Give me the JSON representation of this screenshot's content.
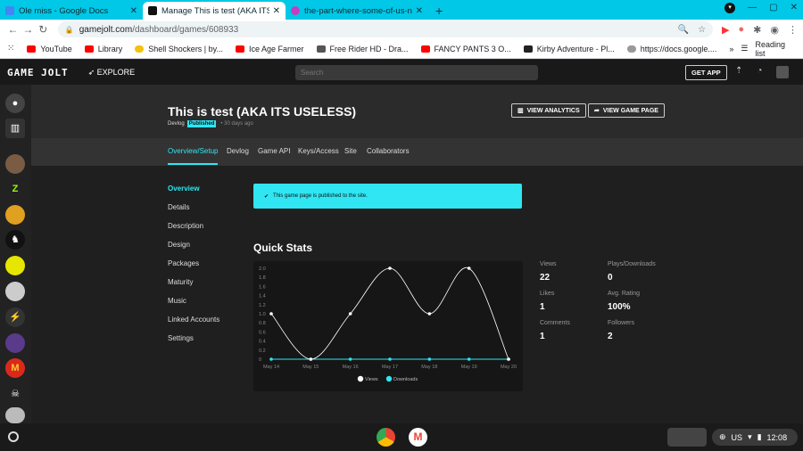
{
  "browser": {
    "tabs": [
      {
        "title": "Ole miss - Google Docs",
        "color": "#4285f4"
      },
      {
        "title": "Manage This is test (AKA ITS US",
        "color": "#111111"
      },
      {
        "title": "the-part-where-some-of-us-need-",
        "color": "#c040c0"
      }
    ],
    "new_tab": "+",
    "url_host": "gamejolt.com",
    "url_path": "/dashboard/games/608933",
    "bookmarks": [
      {
        "label": "YouTube",
        "color": "#ff0000"
      },
      {
        "label": "Library",
        "color": "#ff0000"
      },
      {
        "label": "Shell Shockers | by...",
        "color": "#f4c20d"
      },
      {
        "label": "Ice Age Farmer",
        "color": "#ff0000"
      },
      {
        "label": "Free Rider HD - Dra...",
        "color": "#555555"
      },
      {
        "label": "FANCY PANTS 3 O...",
        "color": "#ff0000"
      },
      {
        "label": "Kirby Adventure - Pl...",
        "color": "#222222"
      },
      {
        "label": "https://docs.google....",
        "color": "#999999"
      }
    ],
    "bookmarks_more": "»",
    "reading_list": "Reading list"
  },
  "gj": {
    "logo": "GAME JOLT",
    "explore": "EXPLORE",
    "search_placeholder": "Search",
    "get_app": "GET APP"
  },
  "header": {
    "title": "This is test (AKA ITS USELESS)",
    "badge_devlog": "Devlog",
    "badge_published": "Published",
    "ago": "30 days ago",
    "view_analytics": "VIEW ANALYTICS",
    "view_game_page": "VIEW GAME PAGE"
  },
  "tabs": [
    "Overview/Setup",
    "Devlog",
    "Game API",
    "Keys/Access",
    "Site",
    "Collaborators"
  ],
  "sidebar": [
    "Overview",
    "Details",
    "Description",
    "Design",
    "Packages",
    "Maturity",
    "Music",
    "Linked Accounts",
    "Settings"
  ],
  "notice": "This game page is published to the site.",
  "quick_stats_title": "Quick Stats",
  "stats": [
    {
      "label": "Views",
      "value": "22"
    },
    {
      "label": "Plays/Downloads",
      "value": "0"
    },
    {
      "label": "Likes",
      "value": "1"
    },
    {
      "label": "Avg. Rating",
      "value": "100%"
    },
    {
      "label": "Comments",
      "value": "1"
    },
    {
      "label": "Followers",
      "value": "2"
    }
  ],
  "chart_data": {
    "type": "line",
    "x": [
      "May 14",
      "May 15",
      "May 16",
      "May 17",
      "May 18",
      "May 19",
      "May 20"
    ],
    "series": [
      {
        "name": "Views",
        "values": [
          1,
          0,
          1,
          2,
          1,
          2,
          0
        ],
        "color": "#ffffff"
      },
      {
        "name": "Downloads",
        "values": [
          0,
          0,
          0,
          0,
          0,
          0,
          0
        ],
        "color": "#2fe6f2"
      }
    ],
    "yticks": [
      "2.0",
      "1.8",
      "1.6",
      "1.4",
      "1.2",
      "1.0",
      "0.8",
      "0.6",
      "0.4",
      "0.2",
      "0"
    ],
    "ylim": [
      0,
      2
    ]
  },
  "tray": {
    "lang": "US",
    "time": "12:08"
  }
}
